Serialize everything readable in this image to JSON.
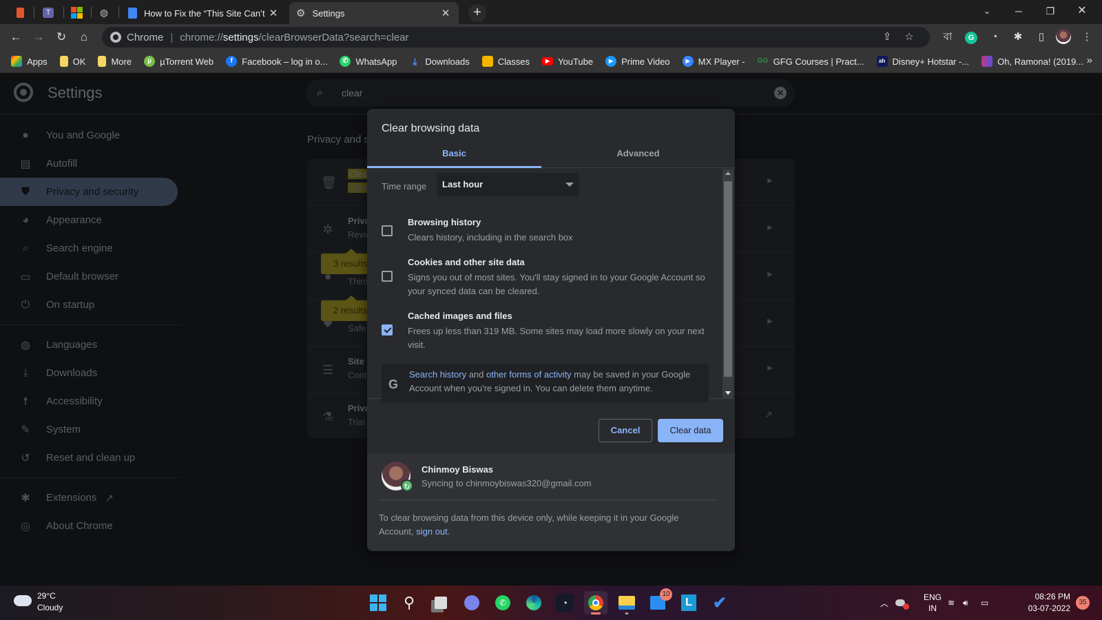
{
  "browser": {
    "pinned_tabs": [
      {
        "name": "office-icon",
        "color": "#e3562b"
      },
      {
        "name": "teams-icon",
        "color": "#6264a7"
      },
      {
        "name": "microsoft-store-icon",
        "color": "#f25022"
      },
      {
        "name": "globe-icon",
        "color": "#bbbbbb"
      }
    ],
    "tabs": [
      {
        "title": "How to Fix the “This Site Can’t Be",
        "icon": "docs-icon",
        "active": false
      },
      {
        "title": "Settings",
        "icon": "gear-icon",
        "active": true
      }
    ],
    "address": {
      "prefix": "Chrome",
      "url_scheme": "chrome://",
      "url_host": "settings",
      "url_path": "/clearBrowserData?search=clear"
    },
    "extension_letter": "বা",
    "bookmarks": [
      {
        "label": "Apps",
        "icon": "apps-grid-icon",
        "color": "#ea4335"
      },
      {
        "label": "OK",
        "icon": "folder-icon",
        "color": "#f6d564"
      },
      {
        "label": "More",
        "icon": "folder-icon",
        "color": "#f6d564"
      },
      {
        "label": "µTorrent Web",
        "icon": "utorrent-icon",
        "color": "#78c04a"
      },
      {
        "label": "Facebook – log in o...",
        "icon": "facebook-icon",
        "color": "#1877f2"
      },
      {
        "label": "WhatsApp",
        "icon": "whatsapp-icon",
        "color": "#25d366"
      },
      {
        "label": "Downloads",
        "icon": "download-icon",
        "color": "#4a8af4"
      },
      {
        "label": "Classes",
        "icon": "classroom-icon",
        "color": "#f4b400"
      },
      {
        "label": "YouTube",
        "icon": "youtube-icon",
        "color": "#ff0000"
      },
      {
        "label": "Prime Video",
        "icon": "prime-video-icon",
        "color": "#1a98ff"
      },
      {
        "label": "MX Player -",
        "icon": "mx-player-icon",
        "color": "#3a86ff"
      },
      {
        "label": "GFG Courses | Pract...",
        "icon": "gfg-icon",
        "color": "#2f8d46"
      },
      {
        "label": "Disney+ Hotstar -...",
        "icon": "hotstar-icon",
        "color": "#0f1a5c"
      },
      {
        "label": "Oh, Ramona! (2019...",
        "icon": "film-icon",
        "color": "#c13584"
      }
    ]
  },
  "settings": {
    "title": "Settings",
    "search_value": "clear",
    "nav": [
      {
        "label": "You and Google",
        "icon": "person-icon",
        "glyph": "👤"
      },
      {
        "label": "Autofill",
        "icon": "clipboard-icon",
        "glyph": "📋"
      },
      {
        "label": "Privacy and security",
        "icon": "shield-icon",
        "glyph": "⛊",
        "active": true
      },
      {
        "label": "Appearance",
        "icon": "palette-icon",
        "glyph": "🎨"
      },
      {
        "label": "Search engine",
        "icon": "search-icon",
        "glyph": "⌕"
      },
      {
        "label": "Default browser",
        "icon": "browser-icon",
        "glyph": "▭"
      },
      {
        "label": "On startup",
        "icon": "power-icon",
        "glyph": "⏻"
      },
      {
        "label": "Languages",
        "icon": "globe-icon",
        "glyph": "🌐"
      },
      {
        "label": "Downloads",
        "icon": "download-icon",
        "glyph": "⤓"
      },
      {
        "label": "Accessibility",
        "icon": "accessibility-icon",
        "glyph": "♿"
      },
      {
        "label": "System",
        "icon": "wrench-icon",
        "glyph": "🔧"
      },
      {
        "label": "Reset and clean up",
        "icon": "history-icon",
        "glyph": "↺"
      },
      {
        "label": "Extensions",
        "icon": "puzzle-icon",
        "glyph": "✱"
      },
      {
        "label": "About Chrome",
        "icon": "chrome-icon",
        "glyph": "◎"
      }
    ],
    "section_title": "Privacy and s",
    "rows": [
      {
        "title": "Clear",
        "sub": "Clear",
        "icon": "trash-icon",
        "highlight": true
      },
      {
        "title": "Priva",
        "sub": "Revie",
        "icon": "compass-icon"
      },
      {
        "title": "",
        "sub": "Third",
        "icon": "cookie-icon"
      },
      {
        "title": "",
        "sub": "Safe",
        "icon": "shield-icon"
      },
      {
        "title": "Site S",
        "sub": "Cont",
        "icon": "tune-icon"
      },
      {
        "title": "Priva",
        "sub": "Trial",
        "icon": "flask-icon"
      }
    ],
    "bubbles": [
      "3 results",
      "2 results"
    ]
  },
  "dialog": {
    "title": "Clear browsing data",
    "tabs": [
      "Basic",
      "Advanced"
    ],
    "active_tab": "Basic",
    "time_range_label": "Time range",
    "time_range_value": "Last hour",
    "options": [
      {
        "title": "Browsing history",
        "desc": "Clears history, including in the search box",
        "checked": false
      },
      {
        "title": "Cookies and other site data",
        "desc": "Signs you out of most sites. You'll stay signed in to your Google Account so your synced data can be cleared.",
        "checked": false
      },
      {
        "title": "Cached images and files",
        "desc": "Frees up less than 319 MB. Some sites may load more slowly on your next visit.",
        "checked": true
      }
    ],
    "google_notice": {
      "link1": "Search history",
      "mid": " and ",
      "link2": "other forms of activity",
      "rest": " may be saved in your Google Account when you're signed in. You can delete them anytime."
    },
    "cancel_label": "Cancel",
    "clear_label": "Clear data",
    "user": {
      "name": "Chinmoy Biswas",
      "sync": "Syncing to chinmoybiswas320@gmail.com"
    },
    "footer": {
      "text": "To clear browsing data from this device only, while keeping it in your Google Account, ",
      "link": "sign out",
      "end": "."
    }
  },
  "taskbar": {
    "weather_temp": "29°C",
    "weather_cond": "Cloudy",
    "apps": [
      {
        "name": "start-icon"
      },
      {
        "name": "search-icon"
      },
      {
        "name": "task-view-icon"
      },
      {
        "name": "teams-chat-icon"
      },
      {
        "name": "whatsapp-icon"
      },
      {
        "name": "edge-icon"
      },
      {
        "name": "speedometer-icon"
      },
      {
        "name": "chrome-icon",
        "active": true
      },
      {
        "name": "file-explorer-icon",
        "running": true
      },
      {
        "name": "mail-icon",
        "badge": "10"
      },
      {
        "name": "l-app-icon"
      },
      {
        "name": "todo-icon"
      }
    ],
    "lang_top": "ENG",
    "lang_bottom": "IN",
    "time": "08:26 PM",
    "date": "03-07-2022",
    "notifications": "35"
  }
}
